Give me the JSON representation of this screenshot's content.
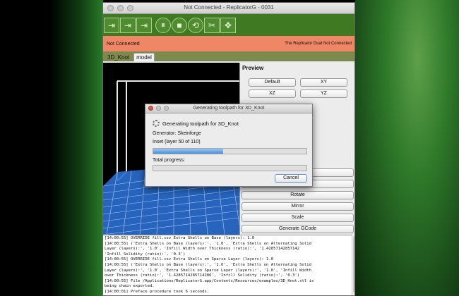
{
  "window": {
    "title": "Not Connected - ReplicatorG - 0031"
  },
  "toolbar": {
    "buttons": [
      {
        "name": "build-button",
        "icon": "play-arrow-icon",
        "glyph": "⇥"
      },
      {
        "name": "build-to-file-button",
        "icon": "play-file-icon",
        "glyph": "⇥"
      },
      {
        "name": "upload-button",
        "icon": "upload-icon",
        "glyph": "⇥"
      },
      {
        "name": "pause-button",
        "icon": "pause-icon",
        "glyph": "⏸"
      },
      {
        "name": "stop-button",
        "icon": "stop-icon",
        "glyph": "■"
      },
      {
        "name": "reset-button",
        "icon": "reset-icon",
        "glyph": "⟲"
      },
      {
        "name": "connect-button",
        "icon": "disconnect-icon",
        "glyph": "✂"
      },
      {
        "name": "control-panel-button",
        "icon": "control-panel-icon",
        "glyph": "✥"
      }
    ]
  },
  "status": {
    "left": "Not Connected",
    "right": "The Replicator Dual Not Connected",
    "color": "#ef8767"
  },
  "tabs": [
    {
      "label": "3D_Knot",
      "active": false
    },
    {
      "label": "model",
      "active": true
    }
  ],
  "preview": {
    "heading": "Preview",
    "buttons": {
      "default": "Default",
      "xy": "XY",
      "xz": "XZ",
      "yz": "YZ",
      "rotate": "Rotate",
      "mirror": "Mirror",
      "scale": "Scale",
      "generate": "Generate GCode"
    }
  },
  "console": {
    "lines": [
      "[14:00:55] OVERRIDE fill.csv Extra Shells on Base (layers): 1.0",
      "[14:00:55] ('Extra Shells on Base (layers):', '1.0', 'Extra Shells on Alternating Solid",
      "Layer (layers):', '1.0', 'Infill Width over Thickness (ratio):', '1.42857142857142",
      "'Infill Solidity (ratio):', '0.3')",
      "[14:00:55] OVERRIDE fill.csv Extra Shells on Sparse Layer (layers): 1.0",
      "[14:00:55] ('Extra Shells on Base (layers):', '1.0', 'Extra Shells on Alternating Solid",
      "Layer (layers):', '1.0', 'Extra Shells on Sparse Layer (layers):', '1.0', 'Infill Width",
      "over Thickness (ratio):', '1.4285714285714286', 'Infill Solidity (ratio):', '0.3')",
      "[14:00:55] File /Applications/ReplicatorG.app/Contents/Resources/examples/3D_Knot.stl is",
      "being chain exported.",
      "[14:00:01] Preface procedure took 6 seconds."
    ]
  },
  "dialog": {
    "title": "Generating toolpath for 3D_Knot",
    "heading": "Generating toolpath for 3D_Knot",
    "generator": "Generator: Skeinforge",
    "stage": "Inset (layer 50 of 110)",
    "stage_progress": 0.455,
    "total_label": "Total progress:",
    "total_progress": 0,
    "cancel": "Cancel"
  }
}
